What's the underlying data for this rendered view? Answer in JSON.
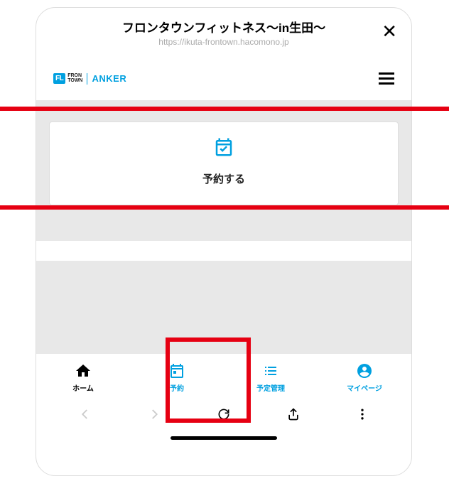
{
  "header": {
    "title": "フロンタウンフィットネス〜in生田〜",
    "url": "https://ikuta-frontown.hacomono.jp"
  },
  "logos": {
    "frontown_badge": "FL",
    "frontown_text_1": "FRON",
    "frontown_text_2": "TOWN",
    "anker": "ANKER"
  },
  "reserve": {
    "label": "予約する"
  },
  "nav": {
    "home": "ホーム",
    "reserve": "予約",
    "schedule": "予定管理",
    "mypage": "マイページ"
  }
}
